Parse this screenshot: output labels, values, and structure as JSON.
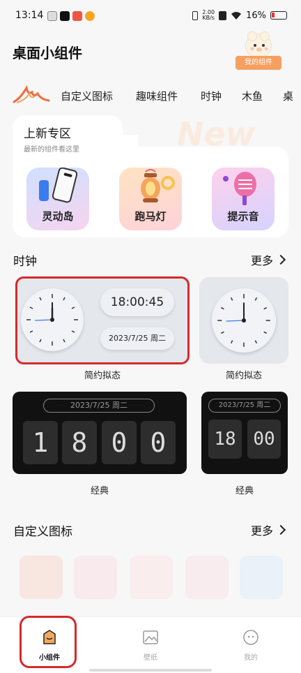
{
  "status_bar": {
    "time": "13:14",
    "net_speed_value": "2.00",
    "net_speed_unit": "KB/s",
    "battery": "16%"
  },
  "header": {
    "title": "桌面小组件",
    "my_widgets_label": "我的组件"
  },
  "tabs": [
    "自定义图标",
    "趣味组件",
    "时钟",
    "木鱼",
    "桌"
  ],
  "new_zone": {
    "title": "上新专区",
    "subtitle": "最新的组件看这里",
    "watermark": "New",
    "items": [
      "灵动岛",
      "跑马灯",
      "提示音"
    ]
  },
  "clock_section": {
    "title": "时钟",
    "more_label": "更多",
    "minimal": {
      "time": "18:00:45",
      "date": "2023/7/25 周二",
      "caption": "简约拟态",
      "caption2": "简约拟态"
    },
    "classic": {
      "date": "2023/7/25 周二",
      "digits": [
        "1",
        "8",
        "0",
        "0"
      ],
      "date_small": "2023/7/25 周二",
      "digits_small": [
        "18",
        "00"
      ],
      "caption": "经典",
      "caption2": "经典"
    }
  },
  "icon_section": {
    "title": "自定义图标",
    "more_label": "更多"
  },
  "bottom_nav": [
    "小组件",
    "壁纸",
    "我的"
  ],
  "colors": {
    "accent": "#f5a060",
    "highlight": "#d42a2a"
  }
}
